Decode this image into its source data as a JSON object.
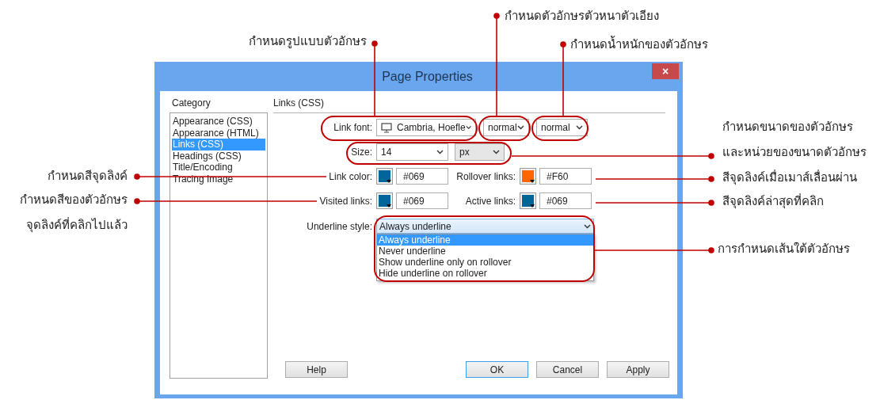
{
  "callouts": [
    {
      "lines": [
        "กำหนดตัวอักษรตัวหนาตัวเอียง"
      ]
    },
    {
      "lines": [
        "กำหนดรูปแบบตัวอักษร"
      ]
    },
    {
      "lines": [
        "กำหนดน้ำหนักของตัวอักษร"
      ]
    },
    {
      "lines": [
        "กำหนดขนาดของตัวอักษร",
        "และหน่วยของขนาดตัวอักษร"
      ]
    },
    {
      "lines": [
        "กำหนดสีจุดลิงค์"
      ]
    },
    {
      "lines": [
        "สีจุดลิงค์เมื่อเมาส์เลื่อนผ่าน"
      ]
    },
    {
      "lines": [
        "กำหนดสีของตัวอักษร",
        "จุดลิงค์ที่คลิกไปแล้ว"
      ]
    },
    {
      "lines": [
        "สีจุดลิงค์ล่าสุดที่คลิก"
      ]
    },
    {
      "lines": [
        "การกำหนดเส้นใต้ตัวอักษร"
      ]
    }
  ],
  "dialog": {
    "title": "Page Properties",
    "close": "×",
    "category_label": "Category",
    "categories": [
      {
        "label": "Appearance (CSS)",
        "selected": false
      },
      {
        "label": "Appearance (HTML)",
        "selected": false
      },
      {
        "label": "Links (CSS)",
        "selected": true
      },
      {
        "label": "Headings (CSS)",
        "selected": false
      },
      {
        "label": "Title/Encoding",
        "selected": false
      },
      {
        "label": "Tracing Image",
        "selected": false
      }
    ],
    "section_title": "Links (CSS)",
    "link_font": {
      "label": "Link font:",
      "value": "Cambria, Hoefle"
    },
    "font_style": {
      "value": "normal"
    },
    "font_weight": {
      "value": "normal"
    },
    "size": {
      "label": "Size:",
      "value": "14",
      "unit": "px"
    },
    "colors": [
      {
        "label": "Link color:",
        "color": "#006699",
        "value": "#069"
      },
      {
        "label": "Rollover links:",
        "color": "#ff6600",
        "value": "#F60"
      },
      {
        "label": "Visited links:",
        "color": "#006699",
        "value": "#069"
      },
      {
        "label": "Active links:",
        "color": "#006699",
        "value": "#069"
      }
    ],
    "underline_style": {
      "label": "Underline style:",
      "value": "Always underline",
      "options": [
        {
          "label": "Always underline",
          "selected": true
        },
        {
          "label": "Never underline",
          "selected": false
        },
        {
          "label": "Show underline only on rollover",
          "selected": false
        },
        {
          "label": "Hide underline on rollover",
          "selected": false
        }
      ]
    },
    "buttons": [
      {
        "label": "Help",
        "default": false
      },
      {
        "label": "OK",
        "default": true
      },
      {
        "label": "Cancel",
        "default": false
      },
      {
        "label": "Apply",
        "default": false
      }
    ]
  }
}
